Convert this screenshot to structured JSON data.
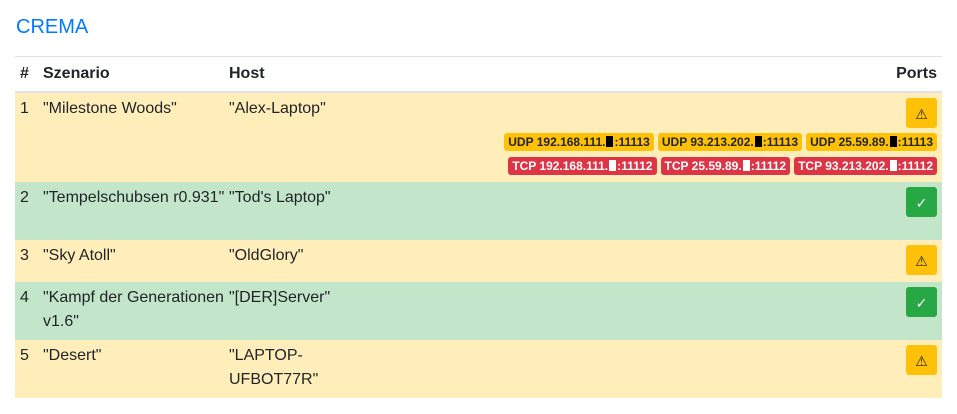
{
  "app": {
    "title": "CREMA"
  },
  "table": {
    "headers": {
      "num": "#",
      "scenario": "Szenario",
      "host": "Host",
      "ports": "Ports"
    },
    "rows": [
      {
        "num": "1",
        "scenario": "\"Milestone Woods\"",
        "host": "\"Alex-Laptop\"",
        "status": "warning",
        "status_icon": "⚠",
        "udp": [
          {
            "prefix": "UDP 192.168.111.",
            "suffix": ":11113"
          },
          {
            "prefix": "UDP 93.213.202.",
            "suffix": ":11113"
          },
          {
            "prefix": "UDP 25.59.89.",
            "suffix": ":11113"
          }
        ],
        "tcp": [
          {
            "prefix": "TCP 192.168.111.",
            "suffix": ":11112"
          },
          {
            "prefix": "TCP 25.59.89.",
            "suffix": ":11112"
          },
          {
            "prefix": "TCP 93.213.202.",
            "suffix": ":11112"
          }
        ]
      },
      {
        "num": "2",
        "scenario": "\"Tempelschubsen r0.931\"",
        "host": "\"Tod's Laptop\"",
        "status": "ok",
        "status_icon": "✓"
      },
      {
        "num": "3",
        "scenario": "\"Sky Atoll\"",
        "host": "\"OldGlory\"",
        "status": "warning",
        "status_icon": "⚠"
      },
      {
        "num": "4",
        "scenario": "\"Kampf der Generationen v1.6\"",
        "host": "\"[DER]Server\"",
        "status": "ok",
        "status_icon": "✓"
      },
      {
        "num": "5",
        "scenario": "\"Desert\"",
        "host": "\"LAPTOP-UFBOT77R\"",
        "status": "warning",
        "status_icon": "⚠"
      }
    ]
  },
  "colors": {
    "accent": "#007bff",
    "row_warning": "#ffeeba",
    "row_ok": "#c3e6cb",
    "badge_udp": "#ffc107",
    "badge_tcp": "#dc3545",
    "button_ok": "#28a745",
    "button_warning": "#ffc107"
  }
}
